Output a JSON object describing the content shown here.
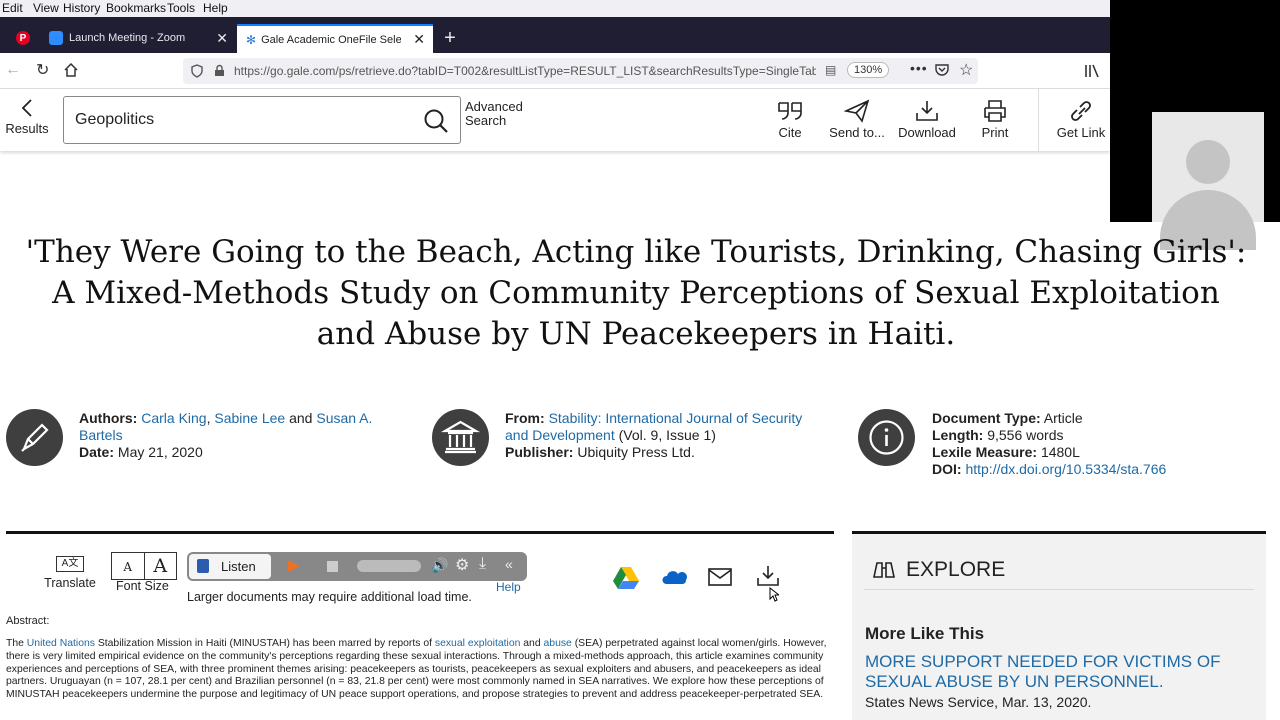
{
  "menubar": {
    "items": [
      "Edit",
      "View",
      "History",
      "Bookmarks",
      "Tools",
      "Help"
    ]
  },
  "tabs": [
    {
      "label": "Launch Meeting - Zoom",
      "active": false
    },
    {
      "label": "Gale Academic OneFile Select",
      "active": true
    }
  ],
  "new_tab": "+",
  "urlbar": {
    "url": "https://go.gale.com/ps/retrieve.do?tabID=T002&resultListType=RESULT_LIST&searchResultsType=SingleTab&",
    "zoom": "130%"
  },
  "gale": {
    "results_label": "Results",
    "search_value": "Geopolitics",
    "advanced_search": [
      "Advanced",
      "Search"
    ],
    "tools": [
      "Cite",
      "Send to...",
      "Download",
      "Print",
      "Get Link"
    ]
  },
  "article": {
    "title_lines": [
      "'They Were Going to the Beach, Acting like Tourists, Drinking, Chasing Girls':",
      "A Mixed-Methods Study on Community Perceptions of Sexual Exploitation",
      "and Abuse by UN Peacekeepers in Haiti."
    ],
    "authors_label": "Authors:",
    "author1": "Carla King",
    "author2": "Sabine Lee",
    "and": "and",
    "author3a": "Susan A.",
    "author3b": "Bartels",
    "date_label": "Date:",
    "date": "May 21, 2020",
    "from_label": "From:",
    "journal_a": "Stability: International Journal of Security",
    "journal_b": "and Development",
    "volume": "(Vol. 9, Issue 1)",
    "publisher_label": "Publisher:",
    "publisher": "Ubiquity Press Ltd.",
    "doctype_label": "Document Type:",
    "doctype": "Article",
    "length_label": "Length:",
    "length": "9,556 words",
    "lexile_label": "Lexile Measure:",
    "lexile": "1480L",
    "doi_label": "DOI:",
    "doi": "http://dx.doi.org/10.5334/sta.766"
  },
  "doc_tools": {
    "translate": "Translate",
    "font_size": "Font Size",
    "font_small": "A",
    "font_large": "A",
    "listen": "Listen",
    "help": "Help",
    "load_note": "Larger documents may require additional load time."
  },
  "abstract": {
    "label": "Abstract:",
    "t1": "The ",
    "l1": "United Nations",
    "t2": " Stabilization Mission in Haiti (MINUSTAH) has been marred by reports of ",
    "l2": "sexual exploitation",
    "t3": " and ",
    "l3": "abuse",
    "t4": " (SEA) perpetrated against local women/girls. However, there is very limited empirical evidence on the community's perceptions regarding these sexual interactions. Through a mixed-methods approach, this article examines community experiences and perceptions of SEA, with three prominent themes arising: peacekeepers as tourists, peacekeepers as sexual exploiters and abusers, and peacekeepers as ideal partners. Uruguayan (n = 107, 28.1 per cent) and Brazilian personnel (n = 83, 21.8 per cent) were most commonly named in SEA narratives. We explore how these perceptions of MINUSTAH peacekeepers undermine the purpose and legitimacy of UN peace support operations, and propose strategies to prevent and address peacekeeper-perpetrated SEA."
  },
  "explore": {
    "title": "EXPLORE",
    "more_like": "More Like This",
    "item_title_a": "MORE SUPPORT NEEDED FOR VICTIMS OF",
    "item_title_b": "SEXUAL ABUSE BY UN PERSONNEL.",
    "item_source": "States News Service, Mar. 13, 2020."
  },
  "colors": {
    "link": "#1f6aa5",
    "tabbar": "#1f1e33",
    "accent": "#0a84ff"
  }
}
